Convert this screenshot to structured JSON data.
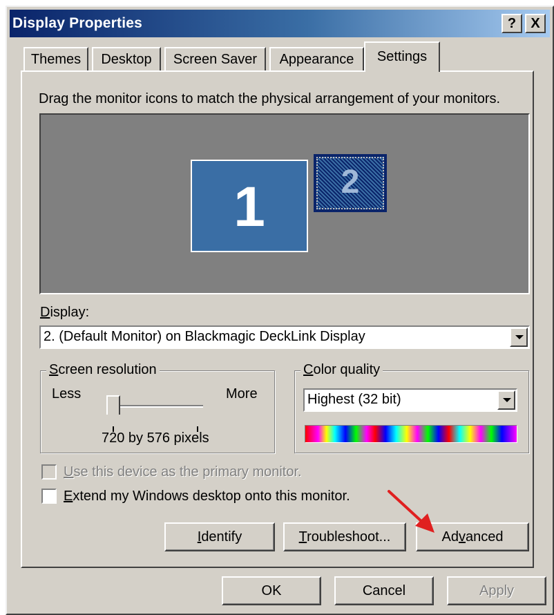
{
  "window": {
    "title": "Display Properties",
    "help_glyph": "?",
    "close_glyph": "X"
  },
  "tabs": [
    {
      "label": "Themes",
      "active": false
    },
    {
      "label": "Desktop",
      "active": false
    },
    {
      "label": "Screen Saver",
      "active": false
    },
    {
      "label": "Appearance",
      "active": false
    },
    {
      "label": "Settings",
      "active": true
    }
  ],
  "settings": {
    "instruction": "Drag the monitor icons to match the physical arrangement of your monitors.",
    "monitors": [
      {
        "number": "1"
      },
      {
        "number": "2",
        "selected": true
      }
    ],
    "display_label_u": "D",
    "display_label_rest": "isplay:",
    "display_value": "2. (Default Monitor) on Blackmagic DeckLink Display",
    "resolution": {
      "legend_u": "S",
      "legend_rest": "creen resolution",
      "less": "Less",
      "more": "More",
      "value": "720 by 576 pixels",
      "slider_position": 0
    },
    "color_quality": {
      "legend_u": "C",
      "legend_rest": "olor quality",
      "value": "Highest (32 bit)"
    },
    "primary_checkbox": {
      "label_u": "U",
      "label_rest": "se this device as the primary monitor.",
      "checked": false,
      "disabled": true
    },
    "extend_checkbox": {
      "label_u": "E",
      "label_rest": "xtend my Windows desktop onto this monitor.",
      "checked": false,
      "disabled": false
    },
    "identify_button": {
      "u": "I",
      "rest": "dentify"
    },
    "troubleshoot_button": {
      "u": "T",
      "rest": "roubleshoot..."
    },
    "advanced_button": {
      "pre": "Ad",
      "u": "v",
      "rest": "anced"
    }
  },
  "footer": {
    "ok_label": "OK",
    "cancel_label": "Cancel",
    "apply_label": "Apply"
  },
  "colors": {
    "annotation_arrow": "#e02020",
    "titlebar_start": "#0a246a",
    "monitor_blue": "#3a6ea5"
  }
}
